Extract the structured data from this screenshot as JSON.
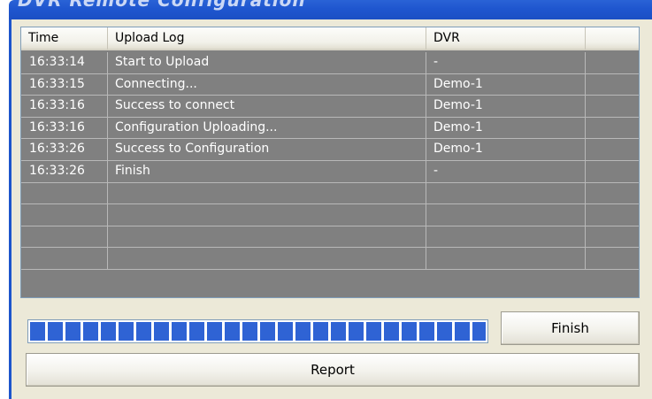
{
  "window": {
    "title": "DVR Remote Configuration"
  },
  "listview": {
    "columns": [
      "Time",
      "Upload Log",
      "DVR",
      ""
    ],
    "rows": [
      {
        "time": "16:33:14",
        "log": "Start to Upload",
        "dvr": "-"
      },
      {
        "time": "16:33:15",
        "log": "Connecting...",
        "dvr": "Demo-1"
      },
      {
        "time": "16:33:16",
        "log": "Success to connect",
        "dvr": "Demo-1"
      },
      {
        "time": "16:33:16",
        "log": "Configuration Uploading...",
        "dvr": "Demo-1"
      },
      {
        "time": "16:33:26",
        "log": "Success to Configuration",
        "dvr": "Demo-1"
      },
      {
        "time": "16:33:26",
        "log": "Finish",
        "dvr": "-"
      },
      {
        "time": "",
        "log": "",
        "dvr": ""
      },
      {
        "time": "",
        "log": "",
        "dvr": ""
      },
      {
        "time": "",
        "log": "",
        "dvr": ""
      },
      {
        "time": "",
        "log": "",
        "dvr": ""
      }
    ]
  },
  "progress": {
    "percent": 100,
    "color": "#2f63d4"
  },
  "buttons": {
    "finish": "Finish",
    "report": "Report"
  }
}
